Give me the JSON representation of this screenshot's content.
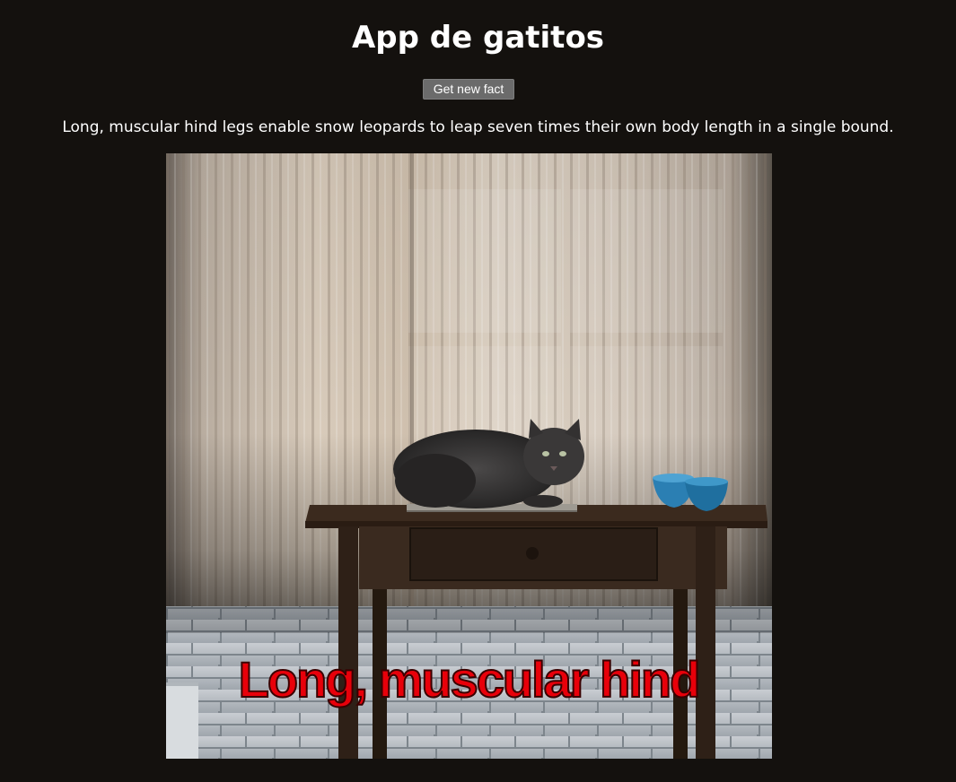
{
  "app": {
    "title": "App de gatitos"
  },
  "controls": {
    "get_new_fact_label": "Get new fact"
  },
  "fact": {
    "text": "Long, muscular hind legs enable snow leopards to leap seven times their own body length in a single bound."
  },
  "image": {
    "overlay_text": "Long, muscular hind",
    "overlay_color": "#e8000a"
  }
}
